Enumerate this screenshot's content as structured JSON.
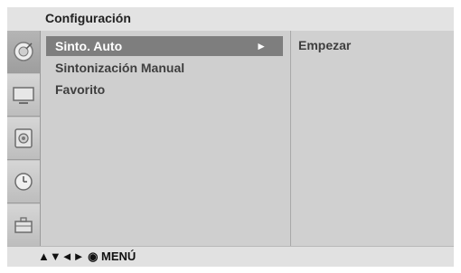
{
  "header": {
    "title": "Configuración"
  },
  "sidebar": {
    "items": [
      {
        "icon": "satellite-dish-icon",
        "active": true
      },
      {
        "icon": "tv-screen-icon",
        "active": false
      },
      {
        "icon": "speaker-icon",
        "active": false
      },
      {
        "icon": "clock-icon",
        "active": false
      },
      {
        "icon": "toolbox-icon",
        "active": false
      }
    ]
  },
  "menu": {
    "items": [
      {
        "label": "Sinto. Auto",
        "selected": true,
        "arrow": "►"
      },
      {
        "label": "Sintonización Manual",
        "selected": false
      },
      {
        "label": "Favorito",
        "selected": false
      }
    ]
  },
  "submenu": {
    "label": "Empezar"
  },
  "footer": {
    "hint": "▲▼◄► ◉ MENÚ"
  }
}
